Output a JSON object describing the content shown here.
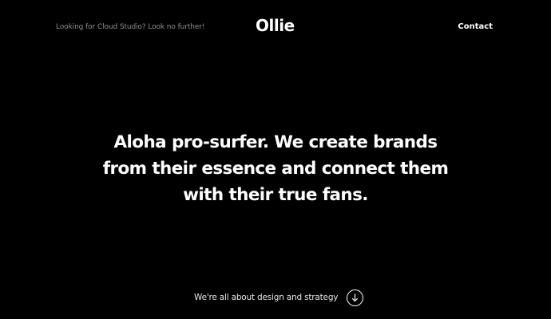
{
  "header": {
    "tagline": "Looking for Cloud Studio? Look no further!",
    "logo": "Ollie",
    "contact_label": "Contact"
  },
  "hero": {
    "line1": "Aloha pro-surfer. We create brands",
    "line2": "from their essence and connect them",
    "line3": "with their true fans."
  },
  "footer": {
    "cta_text": "We're all about design and strategy",
    "scroll_icon": "arrow-down-icon"
  },
  "colors": {
    "background": "#000000",
    "text": "#ffffff",
    "muted": "#8f8f8f"
  }
}
